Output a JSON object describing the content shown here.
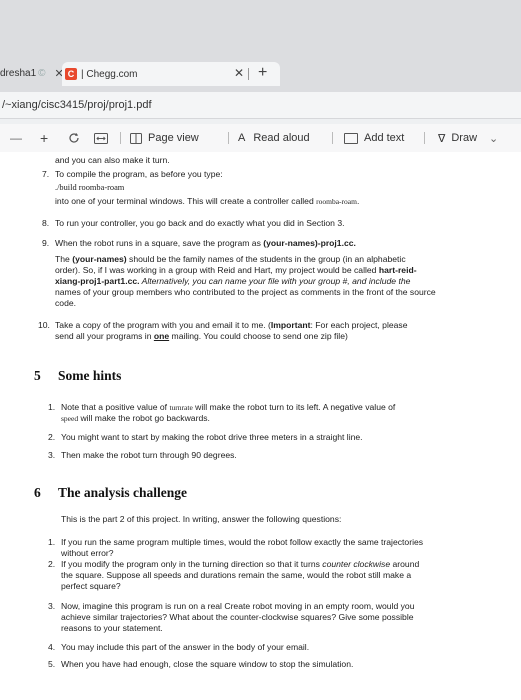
{
  "tabs": {
    "prev_label": "dresha1",
    "prev_fade": "©",
    "active_label": "| Chegg.com",
    "favicon": "C"
  },
  "address": "/~xiang/cisc3415/proj/proj1.pdf",
  "toolbar": {
    "minus": "—",
    "plus": "+",
    "page_view": "Page view",
    "read_aloud": "Read aloud",
    "read_aloud_glyph": "A",
    "add_text": "Add text",
    "draw": "Draw",
    "draw_glyph": "∇",
    "chevron": "⌄"
  },
  "doc": {
    "line_top": "and you can also make it turn.",
    "item7": {
      "num": "7.",
      "text": "To compile the program, as before you type:",
      "cmd": "./build roomba-roam",
      "after_a": "into one of your terminal windows. This will create a controller called ",
      "after_code": "roomba-roam",
      "after_b": "."
    },
    "item8": {
      "num": "8.",
      "text": "To run your controller, you go back and do exactly what you did in Section 3."
    },
    "item9": {
      "num": "9.",
      "line1_a": "When the robot runs in a square, save the program as ",
      "line1_b": "(your-names)-proj1.cc.",
      "line2_a": "The ",
      "line2_b": "(your-names)",
      "line2_c": " should be the family names of the students in the group (in an alphabetic",
      "line3_a": "order). So, if I was working in a group with Reid and Hart, my project would be called ",
      "line3_b": "hart-reid-",
      "line4_a": "xiang-proj1-part1.cc.",
      "line4_b": " Alternatively, you can name your file with your group #, and include the",
      "line5": "names of your group members who contributed to the project as comments in the front of the source",
      "line6": "code."
    },
    "item10": {
      "num": "10.",
      "line1_a": "Take a copy of the program with you and email it to me. (",
      "line1_b": "Important",
      "line1_c": ": For each project, please",
      "line2_a": "send all your programs in ",
      "line2_b": "one",
      "line2_c": " mailing. You could choose to send one zip file)"
    },
    "section5": {
      "num": "5",
      "title": "Some hints"
    },
    "hints": [
      {
        "num": "1.",
        "line1_a": "Note that a positive value of ",
        "line1_code": "turnrate",
        "line1_b": " will make the robot turn to its left. A negative value of",
        "line2_code": "speed",
        "line2_b": " will make the robot go backwards."
      },
      {
        "num": "2.",
        "text": "You might want to start by making the robot drive three meters in a straight line."
      },
      {
        "num": "3.",
        "text": "Then make the robot turn through 90 degrees."
      }
    ],
    "section6": {
      "num": "6",
      "title": "The analysis challenge"
    },
    "intro": "This is the part 2 of this project. In writing, answer the following questions:",
    "questions": [
      {
        "num": "1.",
        "line1": "If you run the same program multiple times, would the robot follow exactly the same trajectories",
        "line2": "without error?"
      },
      {
        "num": "2.",
        "line1_a": "If you modify the program only in the turning direction so that it turns ",
        "line1_i": "counter clockwise",
        "line1_b": " around",
        "line2": "the square. Suppose all speeds and durations remain the same, would the robot still make a",
        "line3": "perfect square?"
      },
      {
        "num": "3.",
        "line1": "Now, imagine this program is run on a real Create robot moving in an empty room, would you",
        "line2": "achieve similar trajectories? What about the counter-clockwise squares? Give some possible",
        "line3": "reasons to your statement."
      },
      {
        "num": "4.",
        "line1": "You may include this part of the answer in the body of your email."
      },
      {
        "num": "5.",
        "line1": "When you have had enough, close the square window to stop the simulation."
      }
    ]
  }
}
